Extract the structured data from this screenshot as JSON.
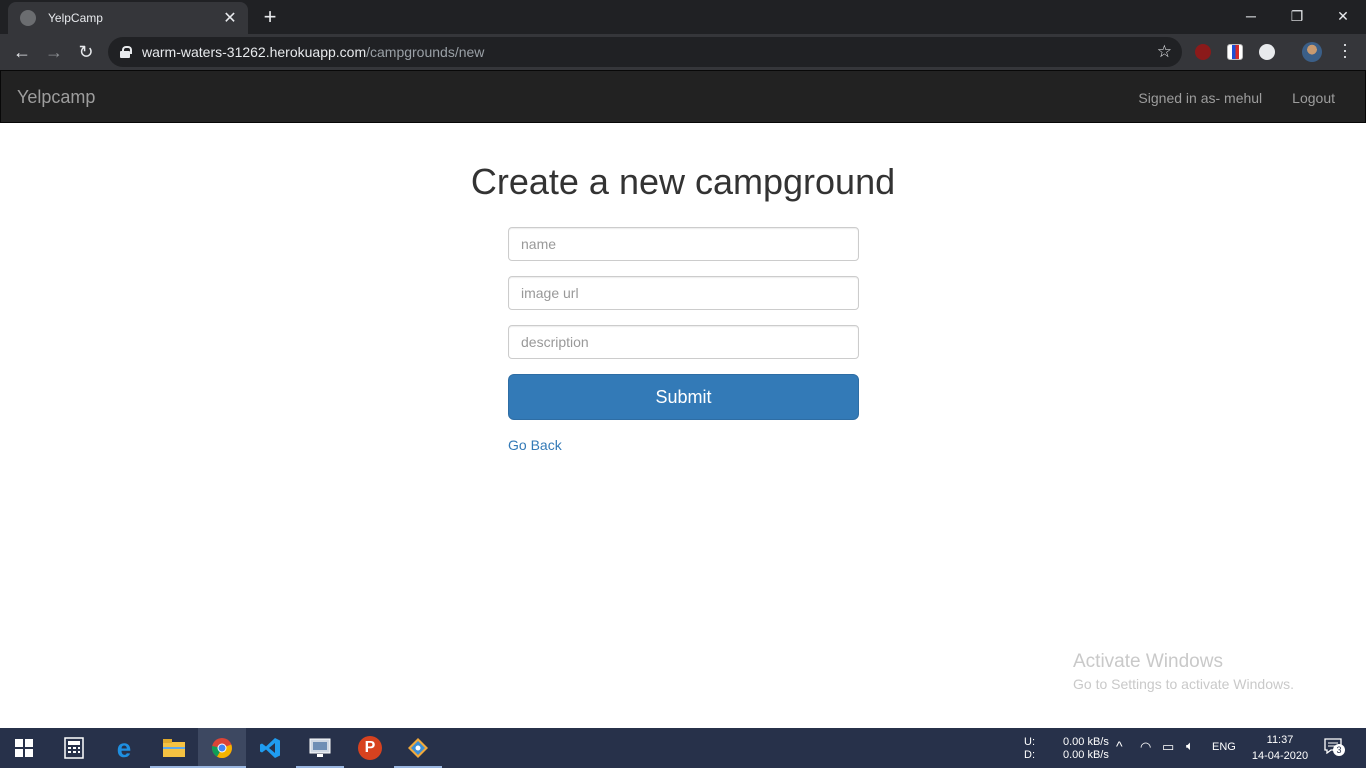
{
  "browser": {
    "tab_title": "YelpCamp",
    "new_tab": "+",
    "close_tab": "✕",
    "url_host": "warm-waters-31262.herokuapp.com",
    "url_path": "/campgrounds/new",
    "window_controls": {
      "minimize": "─",
      "restore": "❐",
      "close": "✕"
    }
  },
  "navbar": {
    "brand": "Yelpcamp",
    "signed_in": "Signed in as- mehul",
    "logout": "Logout"
  },
  "form": {
    "heading": "Create a new campground",
    "name_placeholder": "name",
    "image_placeholder": "image url",
    "description_placeholder": "description",
    "submit_label": "Submit",
    "go_back": "Go Back"
  },
  "watermark": {
    "line1": "Activate Windows",
    "line2": "Go to Settings to activate Windows."
  },
  "taskbar": {
    "net_upload_label": "U:",
    "net_download_label": "D:",
    "net_upload_value": "0.00 kB/s",
    "net_download_value": "0.00 kB/s",
    "language": "ENG",
    "time": "11:37",
    "date": "14-04-2020",
    "notification_count": "3"
  },
  "colors": {
    "primary_button": "#337ab7",
    "navbar_bg": "#222222",
    "link": "#337ab7"
  }
}
